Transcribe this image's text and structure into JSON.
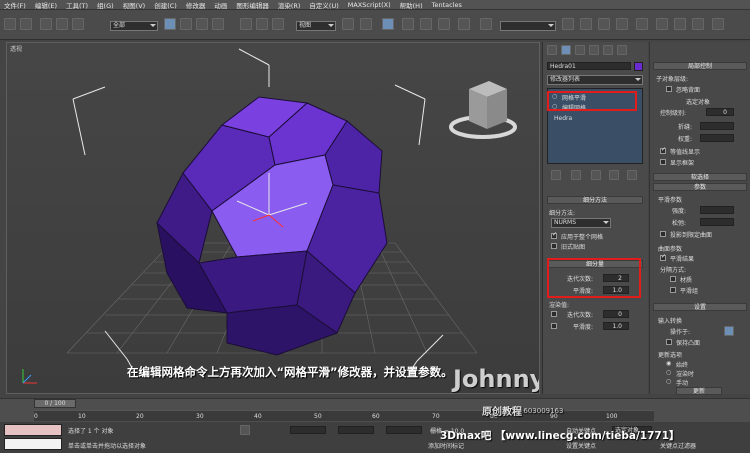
{
  "menu": [
    "文件(F)",
    "编辑(E)",
    "工具(T)",
    "组(G)",
    "视图(V)",
    "创建(C)",
    "修改器",
    "动画",
    "图形编辑器",
    "渲染(R)",
    "自定义(U)",
    "MAXScript(X)",
    "帮助(H)",
    "Tentacles"
  ],
  "toolbar": {
    "selection_filter": "全部",
    "ref_coord": "视图"
  },
  "viewport": {
    "label": "透视"
  },
  "caption": "在编辑网格命令上方再次加入“网格平滑”修改器，并设置参数。",
  "watermark": {
    "name": "Johnny G",
    "studio": "原创教程",
    "qq": "QQ:603009163",
    "site": "3Dmax吧 【www.linecg.com/tieba/1771】"
  },
  "modify": {
    "object_name": "Hedra01",
    "modifier_list": "修改器列表",
    "stack": [
      "网格平滑",
      "编辑网格",
      "Hedra"
    ],
    "color": "#6a2bd0"
  },
  "subdivision": {
    "rollout_method": "细分方法",
    "method_label": "细分方法:",
    "method": "NURMS",
    "apply_whole": "应用于整个网格",
    "old_map": "旧式贴图",
    "rollout_amount": "细分量",
    "iterations_label": "迭代次数:",
    "iterations": "2",
    "smoothness_label": "平滑度:",
    "smoothness": "1.0",
    "render_values": "渲染值:",
    "render_iterations_label": "迭代次数:",
    "render_iterations": "0",
    "render_smooth_label": "平滑度:",
    "render_smooth": "1.0"
  },
  "local_control": {
    "header": "局部控制",
    "sub_level": "子对象层级:",
    "ignore_backface": "忽略背面",
    "selected": "选定对象",
    "ctrl_level": "控制级别:",
    "ctrl_level_val": "0",
    "crease": "折缝:",
    "weight": "权重:",
    "isoline": "等值线显示",
    "show_cage": "显示框架",
    "soft_sel": "软选择",
    "params": "参数",
    "smooth_params": "平滑参数",
    "strength": "强度:",
    "relax": "松弛:",
    "proj": "投影到限定曲面",
    "surface_params": "曲面参数",
    "smooth_result": "平滑结果",
    "separate": "分隔方式:",
    "material": "材质",
    "smooth_group": "平滑组",
    "settings": "设置",
    "input_conv": "输入转换",
    "operate_on": "操作于:",
    "keep_convex": "保持凸面",
    "update_opts": "更新选项",
    "always": "始终",
    "on_render": "渲染时",
    "manual": "手动",
    "update": "更新"
  },
  "timeline": {
    "frame": "0 / 100",
    "ticks": [
      "0",
      "10",
      "20",
      "30",
      "40",
      "50",
      "60",
      "70",
      "80",
      "90",
      "100"
    ]
  },
  "status": {
    "selected": "选择了 1 个 对象",
    "prompt": "单击或单击并拖动以选择对象",
    "add_time": "添加时间标记",
    "grid": "栅格 = 10.0",
    "auto_key": "自动关键点",
    "set_key": "设置关键点",
    "sel_obj": "选定对象",
    "key_filter": "关键点过滤器"
  }
}
